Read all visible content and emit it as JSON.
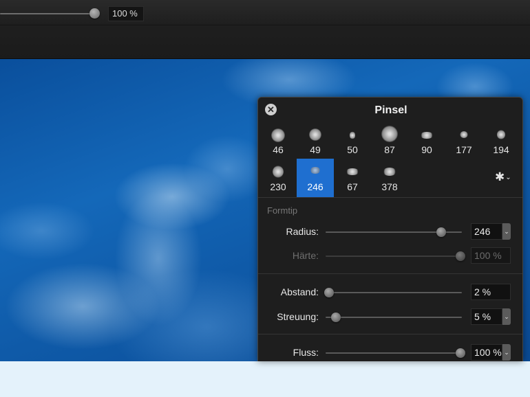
{
  "toolbar": {
    "zoom_value": "100 %"
  },
  "panel": {
    "title": "Pinsel",
    "close_icon": "close-icon",
    "brushes": [
      {
        "size": "46"
      },
      {
        "size": "49"
      },
      {
        "size": "50"
      },
      {
        "size": "87"
      },
      {
        "size": "90"
      },
      {
        "size": "177"
      },
      {
        "size": "194"
      },
      {
        "size": "230"
      },
      {
        "size": "246"
      },
      {
        "size": "67"
      },
      {
        "size": "378"
      }
    ],
    "selected_brush": "246",
    "gear_icon": "gear-icon",
    "section_title": "Formtip",
    "radius": {
      "label": "Radius:",
      "value": "246",
      "fraction": 0.85
    },
    "haerte": {
      "label": "Härte:",
      "value": "100 %",
      "fraction": 1.0
    },
    "abstand": {
      "label": "Abstand:",
      "value": "2 %",
      "fraction": 0.0
    },
    "streuung": {
      "label": "Streuung:",
      "value": "5 %",
      "fraction": 0.05
    },
    "fluss": {
      "label": "Fluss:",
      "value": "100 %",
      "fraction": 1.0
    },
    "accent_color": "#1f6fd0"
  }
}
